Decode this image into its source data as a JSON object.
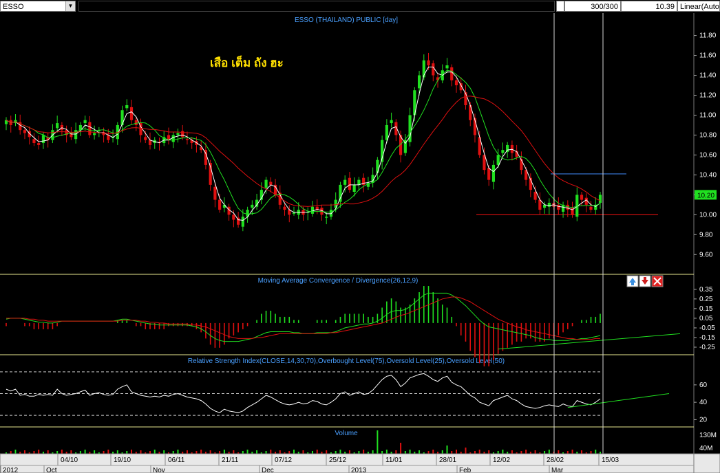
{
  "toolbar": {
    "symbol": "ESSO",
    "bars": "300/300",
    "last": "10.39",
    "scale": "Linear(Auto"
  },
  "colors": {
    "up": "#20e020",
    "down": "#e01010",
    "ma_fast": "#ffffff",
    "ma_mid": "#20e020",
    "ma_slow": "#e01010",
    "title": "#4aa0ff",
    "annotation": "#ffe000",
    "panel_border": "#e8e890"
  },
  "chart_data": [
    {
      "type": "candlestick",
      "title": "ESSO (THAILAND) PUBLIC [day]",
      "annotation": "เสือ เต็ม ถัง  ฮะ",
      "ylim": [
        9.45,
        11.88
      ],
      "yticks": [
        "11.80",
        "11.60",
        "11.40",
        "11.20",
        "11.00",
        "10.80",
        "10.60",
        "10.40",
        "10.20",
        "10.00",
        "9.80",
        "9.60"
      ],
      "last_price": "10.20",
      "support_level": 10.0,
      "resistance_level": 10.41,
      "close": [
        10.95,
        10.9,
        10.95,
        10.85,
        10.82,
        10.78,
        10.72,
        10.7,
        10.8,
        10.75,
        10.85,
        10.92,
        10.85,
        10.8,
        10.78,
        10.85,
        10.9,
        10.95,
        10.8,
        10.82,
        10.85,
        10.8,
        10.75,
        10.78,
        10.9,
        11.05,
        11.1,
        10.95,
        10.9,
        10.8,
        10.75,
        10.7,
        10.75,
        10.72,
        10.78,
        10.75,
        10.8,
        10.82,
        10.78,
        10.75,
        10.72,
        10.7,
        10.65,
        10.5,
        10.3,
        10.15,
        10.05,
        10.1,
        10.0,
        9.95,
        9.9,
        9.98,
        10.05,
        10.1,
        10.15,
        10.25,
        10.35,
        10.3,
        10.2,
        10.1,
        10.05,
        10.0,
        10.02,
        10.05,
        10.0,
        10.03,
        10.08,
        10.05,
        10.0,
        9.98,
        10.05,
        10.15,
        10.3,
        10.35,
        10.25,
        10.3,
        10.35,
        10.3,
        10.32,
        10.4,
        10.55,
        10.75,
        10.9,
        10.95,
        10.8,
        10.6,
        10.75,
        11.0,
        11.25,
        11.4,
        11.55,
        11.5,
        11.4,
        11.35,
        11.45,
        11.5,
        11.35,
        11.3,
        11.25,
        11.1,
        10.95,
        10.8,
        10.6,
        10.45,
        10.35,
        10.5,
        10.6,
        10.65,
        10.7,
        10.62,
        10.58,
        10.45,
        10.35,
        10.25,
        10.15,
        10.05,
        10.1,
        10.12,
        10.08,
        10.05,
        10.1,
        10.05,
        10.0,
        10.2,
        10.15,
        10.1,
        10.05,
        10.1,
        10.2
      ],
      "volume_ticks": [
        "130M",
        "40M"
      ],
      "date_labels": [
        "04/10",
        "19/10",
        "06/11",
        "21/11",
        "07/12",
        "25/12",
        "11/01",
        "28/01",
        "12/02",
        "28/02",
        "15/03"
      ],
      "month_labels": [
        "2012",
        "Oct",
        "Nov",
        "Dec",
        "2013",
        "Feb",
        "Mar"
      ]
    },
    {
      "type": "line",
      "title": "Moving Average Convergence / Divergence(26,12,9)",
      "ylim": [
        -0.3,
        0.37
      ],
      "yticks": [
        "0.35",
        "0.25",
        "0.15",
        "0.05",
        "-0.05",
        "-0.15",
        "-0.25"
      ],
      "macd": [
        0.04,
        0.05,
        0.05,
        0.05,
        0.04,
        0.03,
        0.02,
        0.01,
        0.01,
        0.0,
        0.0,
        0.01,
        0.02,
        0.02,
        0.02,
        0.02,
        0.02,
        0.02,
        0.02,
        0.02,
        0.02,
        0.02,
        0.02,
        0.02,
        0.03,
        0.04,
        0.04,
        0.03,
        0.02,
        0.01,
        0.0,
        -0.01,
        -0.01,
        -0.02,
        -0.02,
        -0.02,
        -0.02,
        -0.02,
        -0.02,
        -0.02,
        -0.03,
        -0.04,
        -0.06,
        -0.09,
        -0.13,
        -0.16,
        -0.18,
        -0.19,
        -0.19,
        -0.19,
        -0.19,
        -0.18,
        -0.17,
        -0.16,
        -0.14,
        -0.12,
        -0.1,
        -0.09,
        -0.09,
        -0.09,
        -0.09,
        -0.09,
        -0.1,
        -0.1,
        -0.11,
        -0.11,
        -0.11,
        -0.1,
        -0.1,
        -0.1,
        -0.1,
        -0.09,
        -0.07,
        -0.05,
        -0.04,
        -0.03,
        -0.02,
        -0.01,
        -0.01,
        0.0,
        0.02,
        0.05,
        0.09,
        0.12,
        0.13,
        0.13,
        0.14,
        0.17,
        0.21,
        0.25,
        0.29,
        0.31,
        0.31,
        0.31,
        0.31,
        0.31,
        0.29,
        0.26,
        0.22,
        0.18,
        0.13,
        0.08,
        0.03,
        -0.01,
        -0.04,
        -0.05,
        -0.06,
        -0.07,
        -0.08,
        -0.09,
        -0.1,
        -0.11,
        -0.12,
        -0.13,
        -0.15,
        -0.16,
        -0.17,
        -0.17,
        -0.18,
        -0.18,
        -0.18,
        -0.18,
        -0.17,
        -0.17,
        -0.16,
        -0.16,
        -0.15,
        -0.14,
        -0.13
      ],
      "signal": [
        0.05,
        0.05,
        0.05,
        0.05,
        0.05,
        0.04,
        0.04,
        0.03,
        0.03,
        0.02,
        0.02,
        0.02,
        0.02,
        0.02,
        0.02,
        0.02,
        0.02,
        0.02,
        0.02,
        0.02,
        0.02,
        0.02,
        0.02,
        0.02,
        0.02,
        0.03,
        0.03,
        0.03,
        0.03,
        0.02,
        0.02,
        0.01,
        0.01,
        0.0,
        0.0,
        -0.01,
        -0.01,
        -0.01,
        -0.01,
        -0.01,
        -0.02,
        -0.02,
        -0.03,
        -0.04,
        -0.06,
        -0.08,
        -0.1,
        -0.12,
        -0.14,
        -0.15,
        -0.16,
        -0.16,
        -0.16,
        -0.16,
        -0.15,
        -0.15,
        -0.14,
        -0.13,
        -0.12,
        -0.11,
        -0.11,
        -0.11,
        -0.11,
        -0.11,
        -0.11,
        -0.11,
        -0.11,
        -0.11,
        -0.11,
        -0.11,
        -0.1,
        -0.1,
        -0.09,
        -0.08,
        -0.07,
        -0.06,
        -0.05,
        -0.04,
        -0.03,
        -0.02,
        -0.01,
        0.0,
        0.02,
        0.04,
        0.06,
        0.08,
        0.09,
        0.11,
        0.13,
        0.15,
        0.17,
        0.19,
        0.21,
        0.23,
        0.25,
        0.26,
        0.27,
        0.27,
        0.26,
        0.24,
        0.22,
        0.19,
        0.16,
        0.13,
        0.1,
        0.07,
        0.04,
        0.02,
        0.0,
        -0.02,
        -0.04,
        -0.05,
        -0.07,
        -0.08,
        -0.09,
        -0.1,
        -0.11,
        -0.12,
        -0.13,
        -0.14,
        -0.15,
        -0.16,
        -0.16,
        -0.17,
        -0.17,
        -0.17,
        -0.17,
        -0.16,
        -0.16
      ]
    },
    {
      "type": "line",
      "title": "Relative Strength Index(CLOSE,14,30,70),Overbought Level(75),Oversold Level(25),Oversold Level(50)",
      "ylim": [
        14,
        82
      ],
      "yticks": [
        "60",
        "40",
        "20"
      ],
      "levels": [
        75,
        50,
        25
      ],
      "rsi": [
        55,
        53,
        55,
        48,
        49,
        47,
        47,
        49,
        48,
        49,
        48,
        55,
        50,
        48,
        49,
        50,
        52,
        54,
        48,
        50,
        51,
        49,
        48,
        49,
        55,
        58,
        60,
        52,
        50,
        48,
        47,
        46,
        47,
        46,
        48,
        47,
        49,
        50,
        48,
        46,
        45,
        44,
        42,
        38,
        33,
        30,
        28,
        32,
        30,
        29,
        28,
        30,
        34,
        37,
        40,
        44,
        48,
        46,
        43,
        40,
        38,
        37,
        38,
        40,
        38,
        39,
        42,
        41,
        38,
        37,
        40,
        44,
        50,
        52,
        48,
        50,
        52,
        49,
        50,
        54,
        60,
        66,
        70,
        71,
        66,
        58,
        62,
        68,
        70,
        72,
        73,
        70,
        66,
        64,
        68,
        70,
        63,
        60,
        58,
        53,
        48,
        45,
        40,
        38,
        36,
        42,
        44,
        46,
        48,
        44,
        42,
        38,
        35,
        34,
        33,
        34,
        36,
        37,
        36,
        35,
        38,
        36,
        35,
        42,
        40,
        38,
        37,
        40,
        44
      ],
      "trendline": [
        [
          121,
          34
        ],
        [
          136,
          50
        ]
      ]
    },
    {
      "type": "bar",
      "title": "Volume",
      "volume_ticks": [
        "130M",
        "40M"
      ]
    }
  ]
}
